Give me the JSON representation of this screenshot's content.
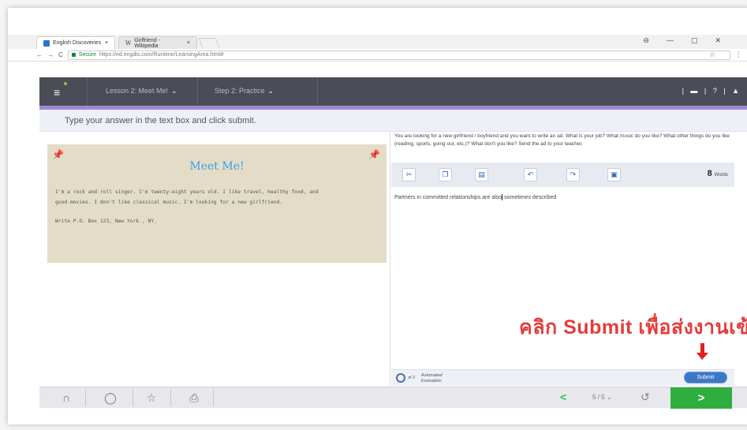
{
  "browser": {
    "tabs": [
      {
        "label": "English Discoveries",
        "close": "×",
        "favicon_color": "#2a73c9",
        "favicon_text": "ED"
      },
      {
        "label": "Girlfriend - Wikipedia",
        "close": "×",
        "favicon_color": "#ffffff",
        "favicon_text": "W"
      }
    ],
    "window_controls": [
      "⊖",
      "—",
      "▢",
      "✕"
    ],
    "secure_label": "Secure",
    "url": "https://ed.engdis.com/Runtime/LearningArea.html#",
    "nav": [
      "←",
      "→",
      "C"
    ]
  },
  "app_header": {
    "lesson": "Lesson 2: Meet Me!",
    "step": "Step 2: Practice",
    "right_icons": "| ▬ | ? | ▲"
  },
  "instruction": "Type your answer in the text box and click submit.",
  "card": {
    "title": "Meet Me!",
    "body_1": "I'm a rock and roll singer. I'm twenty-eight years old. I like travel, healthy food, and",
    "body_2": "good movies. I don't like classical music. I'm looking for a new girlfriend.",
    "address": "Write P.O. Box 123, New York , NY."
  },
  "prompt": "You are looking for a new girlfriend / boyfriend and you want to write an ad. What is your job? What music do you like? What other things do you like (reading, sports, going out, etc.)? What don't you like? Send the ad to your teacher.",
  "toolbar": {
    "icons": [
      "cut-icon",
      "copy-icon",
      "paste-icon",
      "undo-icon",
      "redo-icon",
      "save-icon"
    ],
    "word_count": "8",
    "word_label": "Words"
  },
  "answer_before_caret": "Partners in committed relationships are also",
  "answer_after_caret": " sometimes described",
  "annotation": "คลิก Submit เพื่อส่งงานเข้าระบบ",
  "evaluation": {
    "of": "of 2",
    "label_1": "Automated",
    "label_2": "Evaluation"
  },
  "submit_label": "Submit",
  "bottom": {
    "pager": "5 / 5",
    "pager_chevron": "⌄",
    "prev": "<",
    "next": ">"
  }
}
